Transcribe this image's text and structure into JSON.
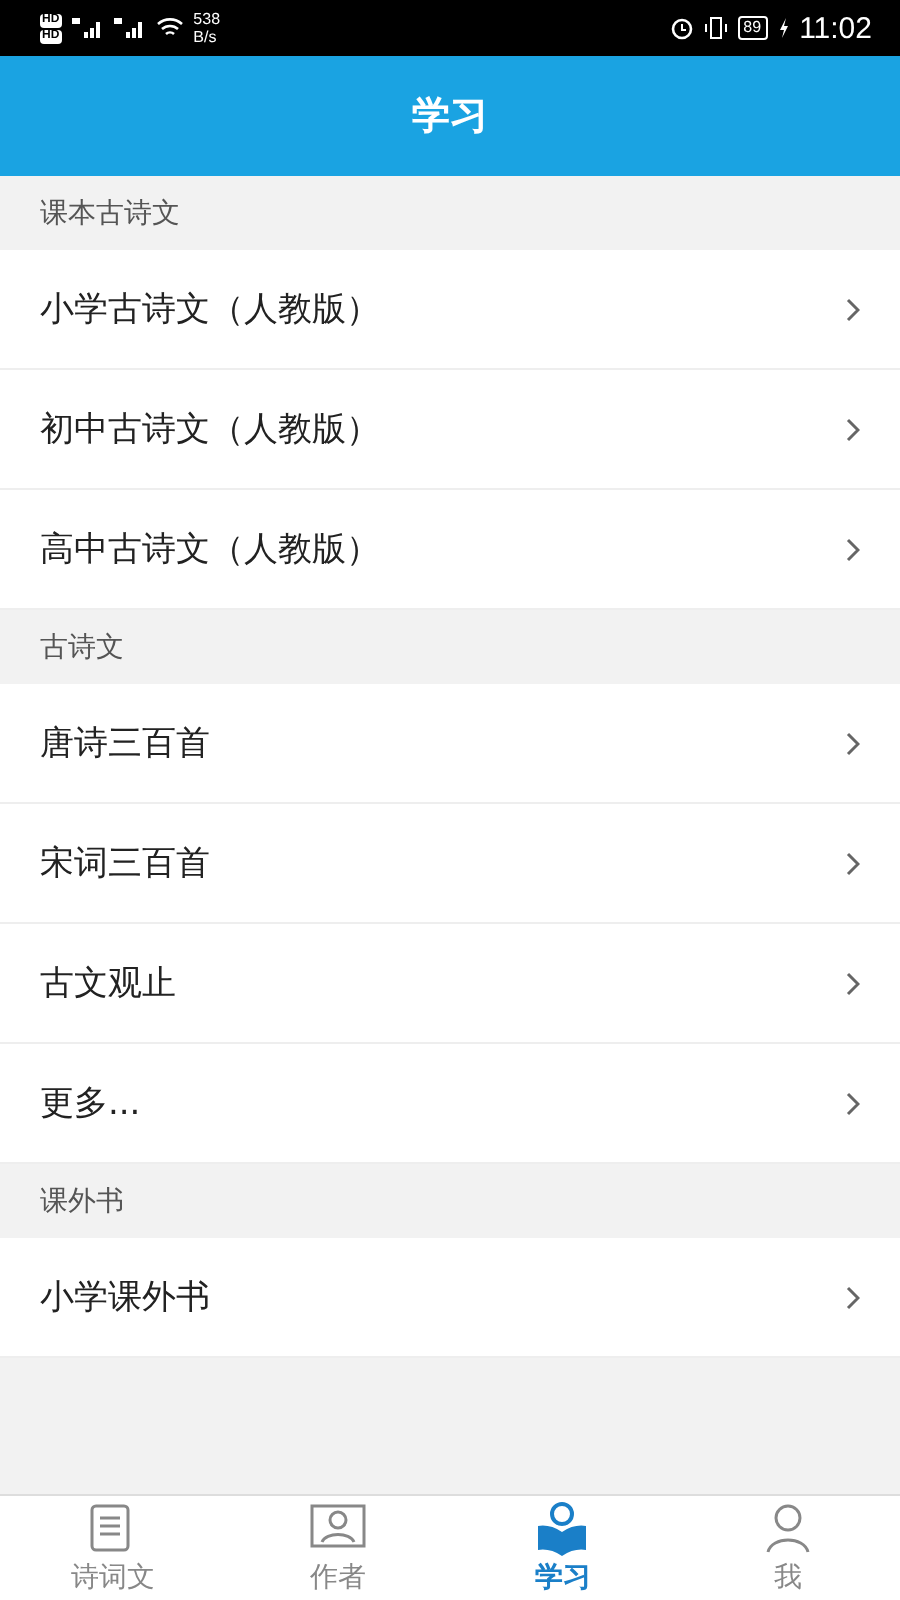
{
  "status_bar": {
    "sim_labels": [
      "HD",
      "HD"
    ],
    "speed_value": "538",
    "speed_unit": "B/s",
    "battery": "89",
    "time": "11:02"
  },
  "header": {
    "title": "学习"
  },
  "sections": [
    {
      "title": "课本古诗文",
      "items": [
        {
          "label": "小学古诗文（人教版）"
        },
        {
          "label": "初中古诗文（人教版）"
        },
        {
          "label": "高中古诗文（人教版）"
        }
      ]
    },
    {
      "title": "古诗文",
      "items": [
        {
          "label": "唐诗三百首"
        },
        {
          "label": "宋词三百首"
        },
        {
          "label": "古文观止"
        },
        {
          "label": "更多..."
        }
      ]
    },
    {
      "title": "课外书",
      "items": [
        {
          "label": "小学课外书"
        }
      ]
    }
  ],
  "tab_bar": [
    {
      "label": "诗词文",
      "kind": "list",
      "selected": false
    },
    {
      "label": "作者",
      "kind": "portrait",
      "selected": false
    },
    {
      "label": "学习",
      "kind": "reader",
      "selected": true
    },
    {
      "label": "我",
      "kind": "person",
      "selected": false
    }
  ]
}
